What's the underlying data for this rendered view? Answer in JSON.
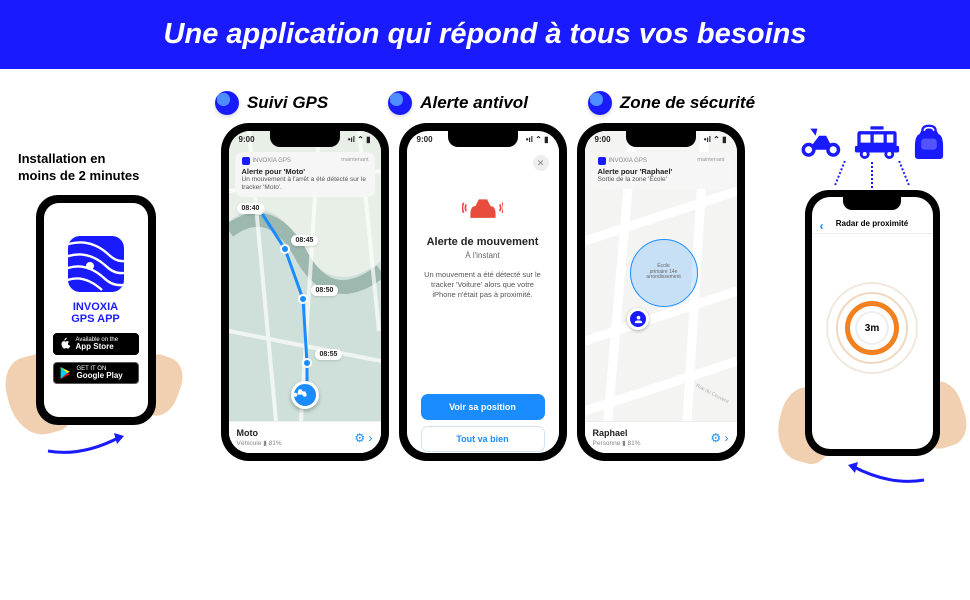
{
  "banner": "Une application qui répond à tous vos besoins",
  "features": [
    {
      "label": "Suivi GPS"
    },
    {
      "label": "Alerte antivol"
    },
    {
      "label": "Zone de sécurité"
    }
  ],
  "left": {
    "install_line1": "Installation en",
    "install_line2": "moins de 2 minutes",
    "app_name_l1": "INVOXIA",
    "app_name_l2": "GPS APP",
    "appstore_small": "Available on the",
    "appstore_big": "App Store",
    "play_small": "GET IT ON",
    "play_big": "Google Play"
  },
  "phone1": {
    "time": "9:00",
    "notif_app": "INVOXIA GPS",
    "notif_when": "maintenant",
    "notif_title": "Alerte pour 'Moto'",
    "notif_body": "Un mouvement à l'arrêt a été détecté sur le tracker 'Moto'.",
    "chips": {
      "a": "08:40",
      "b": "08:45",
      "c": "08:50",
      "d": "08:55"
    },
    "footer_name": "Moto",
    "footer_sub": "Véhicule  ▮ 81%"
  },
  "phone2": {
    "alert_title": "Alerte de mouvement",
    "alert_sub": "À l'instant",
    "alert_body": "Un mouvement a été détecté sur le tracker 'Voiture' alors que votre iPhone n'était pas à proximité.",
    "btn_primary": "Voir sa position",
    "btn_secondary": "Tout va bien"
  },
  "phone3": {
    "time": "9:00",
    "notif_app": "INVOXIA GPS",
    "notif_when": "maintenant",
    "notif_title": "Alerte pour 'Raphael'",
    "notif_body": "Sortie de la zone 'École'",
    "zone_l1": "École",
    "zone_l2": "primaire 14e",
    "zone_l3": "arrondissement",
    "street": "Rue du Couvent",
    "footer_name": "Raphael",
    "footer_sub": "Personne  ▮ 81%"
  },
  "right": {
    "radar_title": "Radar de proximité",
    "distance": "3m"
  }
}
